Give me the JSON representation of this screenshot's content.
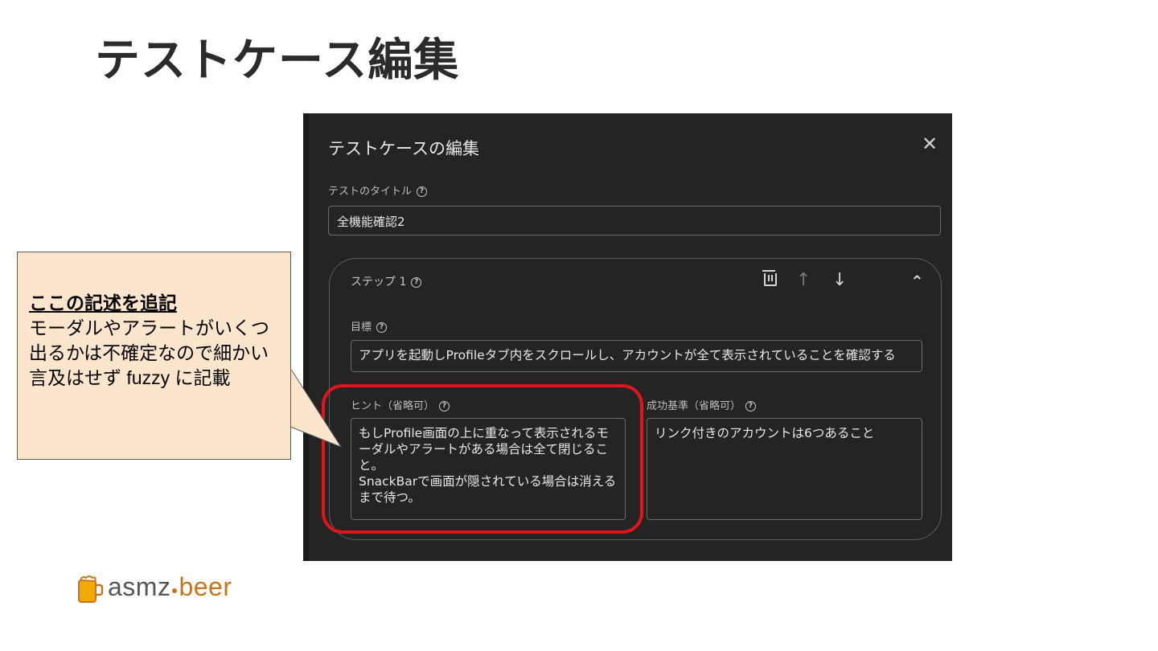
{
  "slide": {
    "title": "テストケース編集"
  },
  "dialog": {
    "title": "テストケースの編集",
    "close_glyph": "✕",
    "test_title_label": "テストのタイトル",
    "test_title_value": "全機能確認2",
    "step": {
      "label": "ステップ 1",
      "actions": {
        "up_glyph": "↑",
        "down_glyph": "↓",
        "collapse_glyph": "⌃"
      },
      "objective_label": "目標",
      "objective_value": "アプリを起動しProfileタブ内をスクロールし、アカウントが全て表示されていることを確認する",
      "hint_label": "ヒント（省略可）",
      "hint_value": "もしProfile画面の上に重なって表示されるモーダルやアラートがある場合は全て閉じること。\nSnackBarで画面が隠されている場合は消えるまで待つ。",
      "success_label": "成功基準（省略可）",
      "success_value": "リンク付きのアカウントは6つあること"
    },
    "help_glyph": "?"
  },
  "callout": {
    "heading": "ここの記述を追記",
    "body": "モーダルやアラートがいくつ出るかは不確定なので細かい言及はせず fuzzy に記載"
  },
  "logo": {
    "part1": "asmz",
    "part2": "beer"
  },
  "colors": {
    "dialog_bg": "#242424",
    "highlight_ring": "#e0141c",
    "callout_bg": "#fce5cd",
    "logo_gray": "#555555",
    "logo_accent": "#c8741a"
  }
}
